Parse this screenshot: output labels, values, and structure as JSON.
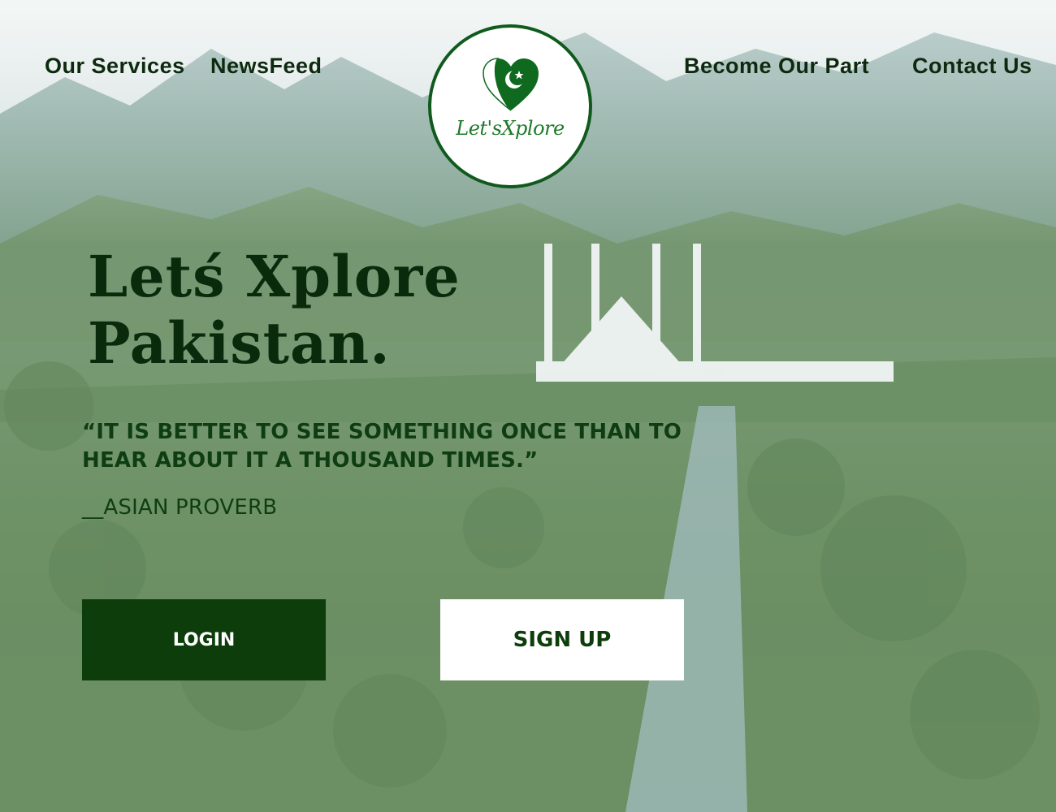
{
  "nav": {
    "left": [
      "Our Services",
      "NewsFeed"
    ],
    "right": [
      "Become Our Part",
      "Contact Us"
    ]
  },
  "logo": {
    "text": "Let'sXplore",
    "icon": "pakistan-heart-icon"
  },
  "hero": {
    "title_line1": "Letś Xplore",
    "title_line2": "Pakistan.",
    "quote": "“IT IS BETTER TO SEE SOMETHING ONCE THAN TO HEAR ABOUT IT A THOUSAND TIMES.”",
    "attribution": "__ASIAN PROVERB"
  },
  "buttons": {
    "login": "LOGIN",
    "signup": "SIGN UP"
  },
  "colors": {
    "dark_green": "#0c3d0a",
    "logo_green": "#0f5a1c",
    "white": "#ffffff"
  }
}
